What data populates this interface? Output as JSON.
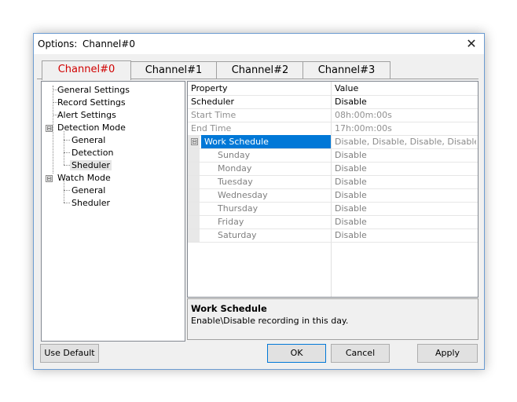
{
  "window": {
    "title_prefix": "Options:",
    "title_channel": "Channel#0",
    "close_glyph": "✕"
  },
  "tabs": [
    {
      "label": "Channel#0",
      "active": true
    },
    {
      "label": "Channel#1",
      "active": false
    },
    {
      "label": "Channel#2",
      "active": false
    },
    {
      "label": "Channel#3",
      "active": false
    }
  ],
  "tree": {
    "items": [
      {
        "label": "General Settings"
      },
      {
        "label": "Record Settings"
      },
      {
        "label": "Alert Settings"
      },
      {
        "label": "Detection Mode",
        "expander": "⊟"
      },
      {
        "label": "General"
      },
      {
        "label": "Detection"
      },
      {
        "label": "Sheduler"
      },
      {
        "label": "Watch Mode",
        "expander": "⊟"
      },
      {
        "label": "General"
      },
      {
        "label": "Sheduler"
      }
    ]
  },
  "grid": {
    "header": {
      "property": "Property",
      "value": "Value"
    },
    "rows": [
      {
        "property": "Scheduler",
        "value": "Disable"
      },
      {
        "property": "Start Time",
        "value": "08h:00m:00s"
      },
      {
        "property": "End Time",
        "value": "17h:00m:00s"
      },
      {
        "property": "Work Schedule",
        "value": "Disable, Disable, Disable, Disable, ...",
        "expander": "⊟"
      },
      {
        "property": "Sunday",
        "value": "Disable"
      },
      {
        "property": "Monday",
        "value": "Disable"
      },
      {
        "property": "Tuesday",
        "value": "Disable"
      },
      {
        "property": "Wednesday",
        "value": "Disable"
      },
      {
        "property": "Thursday",
        "value": "Disable"
      },
      {
        "property": "Friday",
        "value": "Disable"
      },
      {
        "property": "Saturday",
        "value": "Disable"
      }
    ]
  },
  "description": {
    "title": "Work Schedule",
    "text": "Enable\\Disable recording in this day."
  },
  "buttons": {
    "use_default": "Use Default",
    "ok": "OK",
    "cancel": "Cancel",
    "apply": "Apply"
  },
  "colors": {
    "active_tab_text": "#d00000",
    "selection": "#0078d7",
    "window_border": "#6b9bd1"
  }
}
